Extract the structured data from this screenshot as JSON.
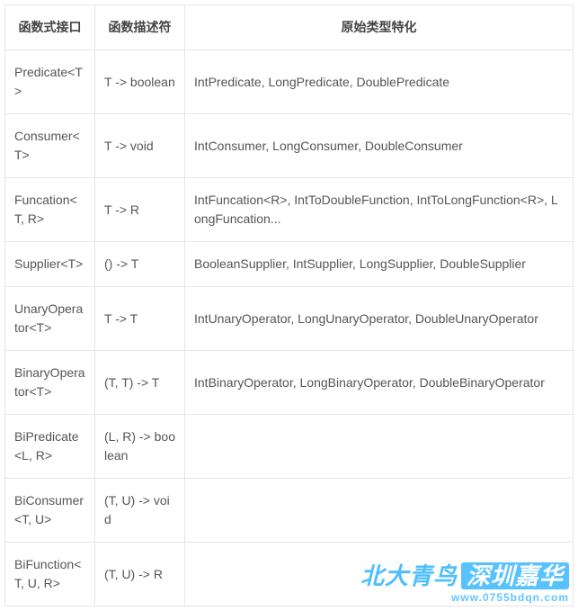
{
  "chart_data": {
    "type": "table",
    "headers": [
      "函数式接口",
      "函数描述符",
      "原始类型特化"
    ],
    "rows": [
      {
        "iface": "Predicate<T>",
        "desc": "T -> boolean",
        "spec": "IntPredicate, LongPredicate, DoublePredicate"
      },
      {
        "iface": "Consumer<T>",
        "desc": "T -> void",
        "spec": "IntConsumer, LongConsumer, DoubleConsumer"
      },
      {
        "iface": "Funcation<T, R>",
        "desc": "T -> R",
        "spec": "IntFuncation<R>, IntToDoubleFunction, IntToLongFunction<R>, LongFuncation..."
      },
      {
        "iface": "Supplier<T>",
        "desc": "() -> T",
        "spec": "BooleanSupplier, IntSupplier, LongSupplier, DoubleSupplier"
      },
      {
        "iface": "UnaryOperator<T>",
        "desc": "T -> T",
        "spec": "IntUnaryOperator, LongUnaryOperator, DoubleUnaryOperator"
      },
      {
        "iface": "BinaryOperator<T>",
        "desc": "(T, T) -> T",
        "spec": "IntBinaryOperator, LongBinaryOperator, DoubleBinaryOperator"
      },
      {
        "iface": "BiPredicate<L, R>",
        "desc": "(L, R) -> boolean",
        "spec": ""
      },
      {
        "iface": "BiConsumer<T, U>",
        "desc": "(T, U) -> void",
        "spec": ""
      },
      {
        "iface": "BiFunction<T, U, R>",
        "desc": "(T, U) -> R",
        "spec": ""
      }
    ]
  },
  "watermark": {
    "brand_left": "北大青鸟",
    "brand_right": "深圳嘉华",
    "url": "www.0755bdqn.com"
  }
}
